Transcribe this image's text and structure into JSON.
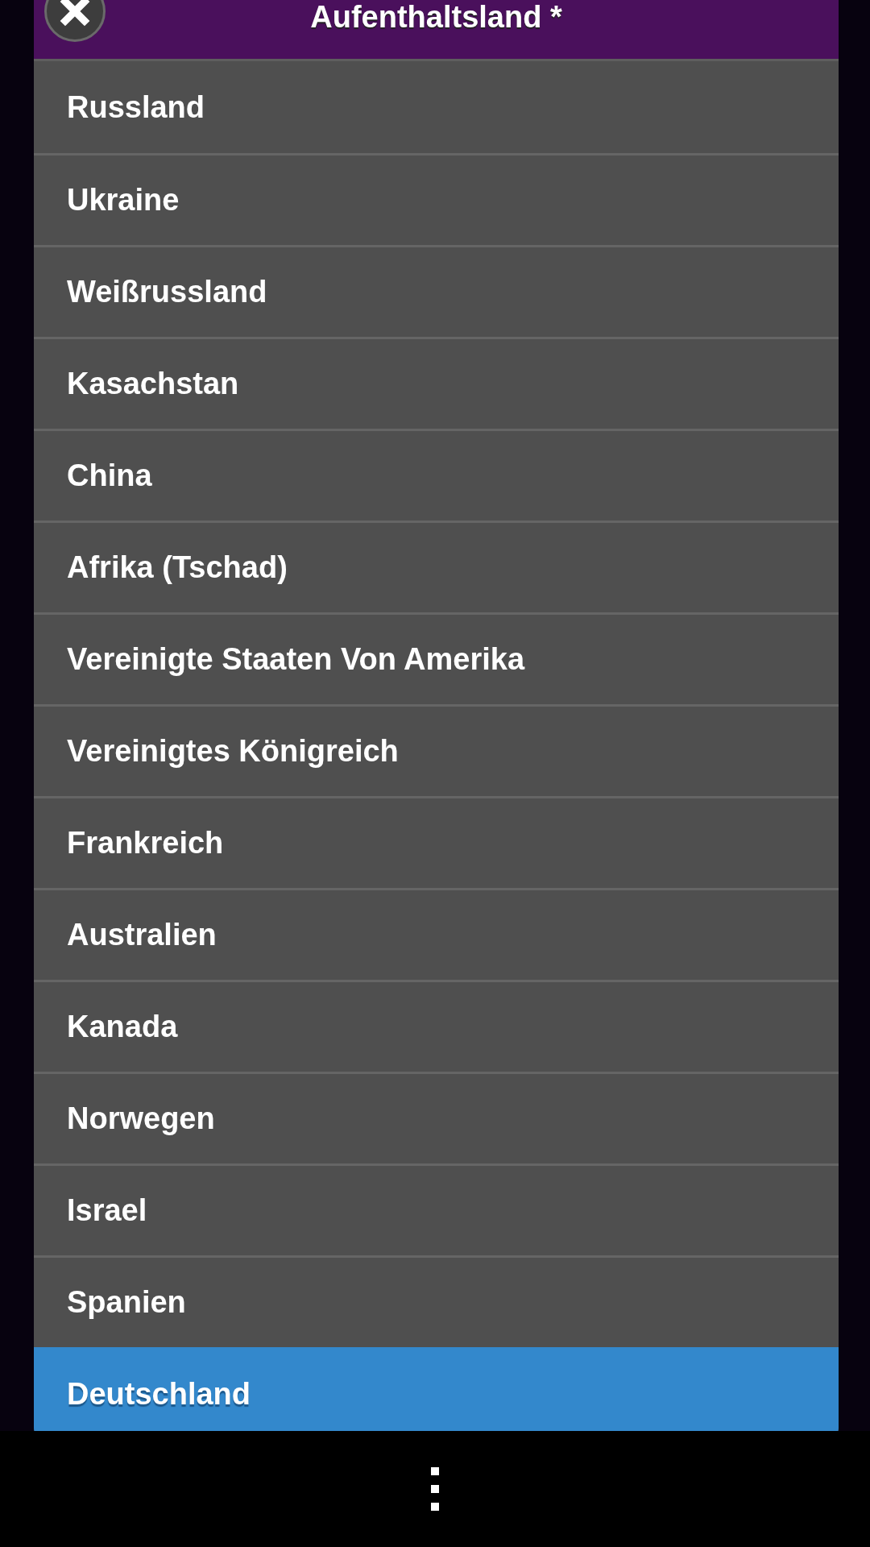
{
  "dialog": {
    "title": "Aufenthaltsland *"
  },
  "items": [
    {
      "label": "Russland",
      "selected": false
    },
    {
      "label": "Ukraine",
      "selected": false
    },
    {
      "label": "Weißrussland",
      "selected": false
    },
    {
      "label": "Kasachstan",
      "selected": false
    },
    {
      "label": "China",
      "selected": false
    },
    {
      "label": "Afrika (Tschad)",
      "selected": false
    },
    {
      "label": "Vereinigte Staaten Von Amerika",
      "selected": false
    },
    {
      "label": "Vereinigtes Königreich",
      "selected": false
    },
    {
      "label": "Frankreich",
      "selected": false
    },
    {
      "label": "Australien",
      "selected": false
    },
    {
      "label": "Kanada",
      "selected": false
    },
    {
      "label": "Norwegen",
      "selected": false
    },
    {
      "label": "Israel",
      "selected": false
    },
    {
      "label": "Spanien",
      "selected": false
    },
    {
      "label": "Deutschland",
      "selected": true
    }
  ]
}
